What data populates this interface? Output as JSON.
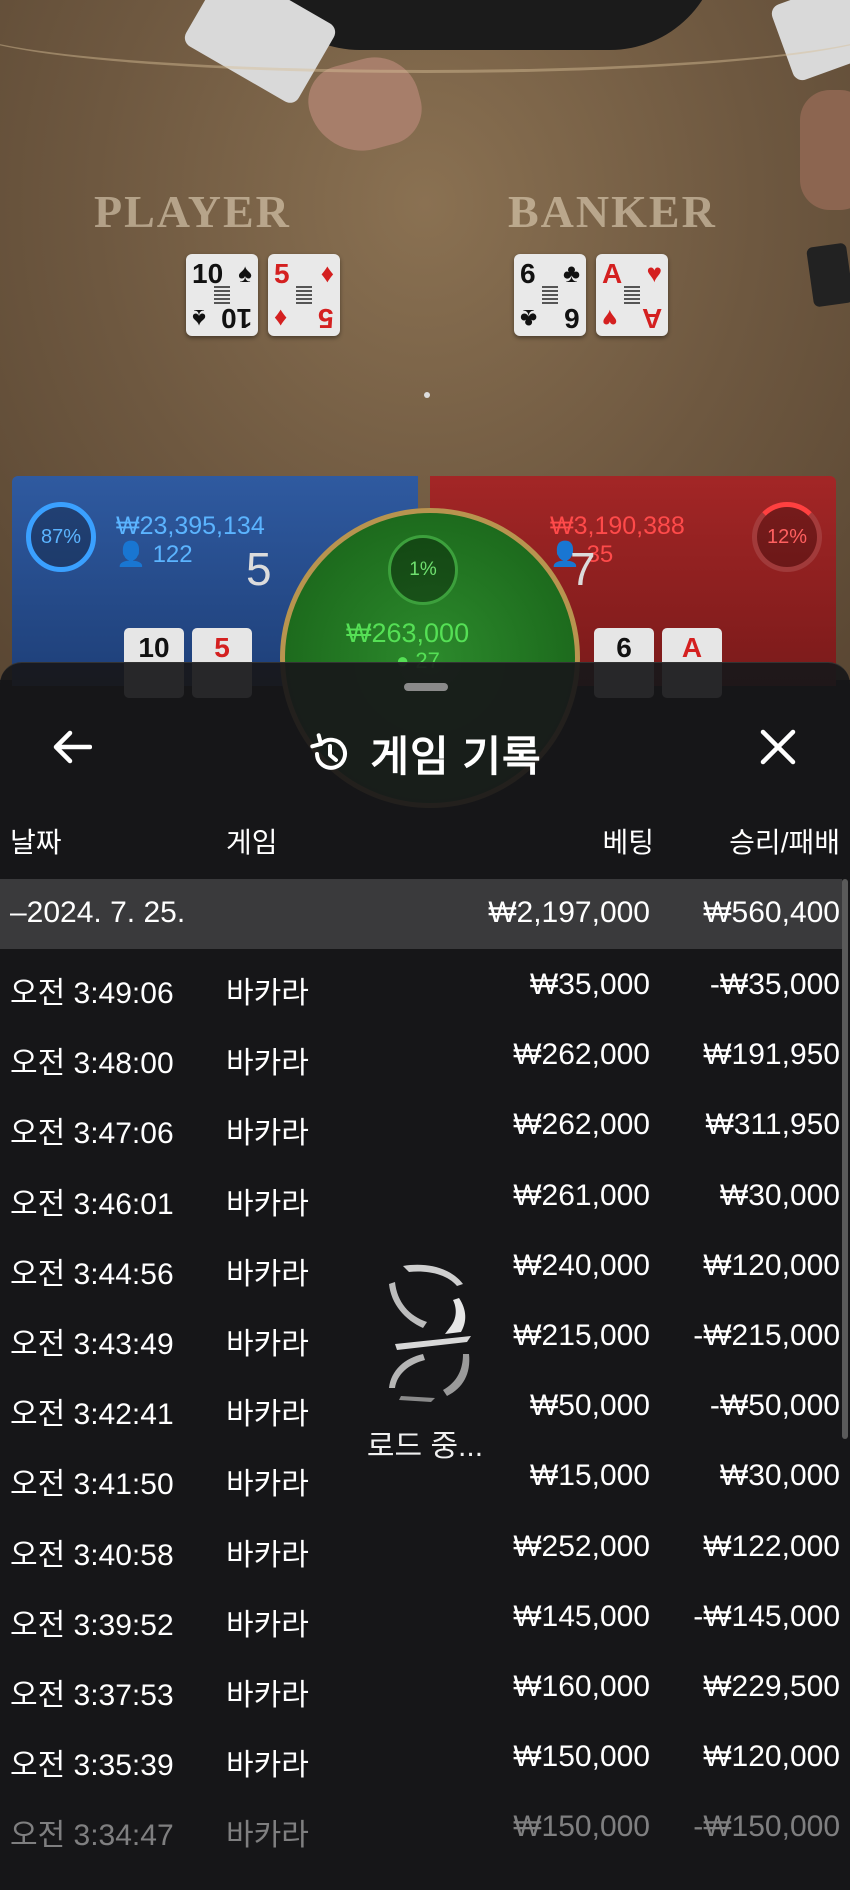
{
  "table": {
    "player_label": "PLAYER",
    "banker_label": "BANKER",
    "player_cards": [
      {
        "rank": "10",
        "suit": "♠",
        "color": "black"
      },
      {
        "rank": "5",
        "suit": "♦",
        "color": "red"
      }
    ],
    "banker_cards": [
      {
        "rank": "6",
        "suit": "♣",
        "color": "black"
      },
      {
        "rank": "A",
        "suit": "♥",
        "color": "red"
      }
    ]
  },
  "bets": {
    "player": {
      "percent": "87%",
      "amount": "₩23,395,134",
      "count": "122",
      "score": "5",
      "cards": [
        "10",
        "5"
      ]
    },
    "banker": {
      "percent": "12%",
      "amount": "₩3,190,388",
      "count": "35",
      "score": "7",
      "cards": [
        "6",
        "A"
      ]
    },
    "tie": {
      "percent": "1%",
      "amount": "₩263,000",
      "count": "27"
    }
  },
  "history": {
    "title": "게임 기록",
    "columns": {
      "date": "날짜",
      "game": "게임",
      "bet": "베팅",
      "win_loss": "승리/패배"
    },
    "date_group": {
      "label": "–2024. 7. 25.",
      "bet": "₩2,197,000",
      "win_loss": "₩560,400"
    },
    "rows": [
      {
        "time": "오전 3:49:06",
        "game": "바카라",
        "bet": "₩35,000",
        "win_loss": "-₩35,000"
      },
      {
        "time": "오전 3:48:00",
        "game": "바카라",
        "bet": "₩262,000",
        "win_loss": "₩191,950"
      },
      {
        "time": "오전 3:47:06",
        "game": "바카라",
        "bet": "₩262,000",
        "win_loss": "₩311,950"
      },
      {
        "time": "오전 3:46:01",
        "game": "바카라",
        "bet": "₩261,000",
        "win_loss": "₩30,000"
      },
      {
        "time": "오전 3:44:56",
        "game": "바카라",
        "bet": "₩240,000",
        "win_loss": "₩120,000"
      },
      {
        "time": "오전 3:43:49",
        "game": "바카라",
        "bet": "₩215,000",
        "win_loss": "-₩215,000"
      },
      {
        "time": "오전 3:42:41",
        "game": "바카라",
        "bet": "₩50,000",
        "win_loss": "-₩50,000"
      },
      {
        "time": "오전 3:41:50",
        "game": "바카라",
        "bet": "₩15,000",
        "win_loss": "₩30,000"
      },
      {
        "time": "오전 3:40:58",
        "game": "바카라",
        "bet": "₩252,000",
        "win_loss": "₩122,000"
      },
      {
        "time": "오전 3:39:52",
        "game": "바카라",
        "bet": "₩145,000",
        "win_loss": "-₩145,000"
      },
      {
        "time": "오전 3:37:53",
        "game": "바카라",
        "bet": "₩160,000",
        "win_loss": "₩229,500"
      },
      {
        "time": "오전 3:35:39",
        "game": "바카라",
        "bet": "₩150,000",
        "win_loss": "₩120,000"
      },
      {
        "time": "오전 3:34:47",
        "game": "바카라",
        "bet": "₩150,000",
        "win_loss": "-₩150,000"
      }
    ],
    "loading_text": "로드 중..."
  }
}
